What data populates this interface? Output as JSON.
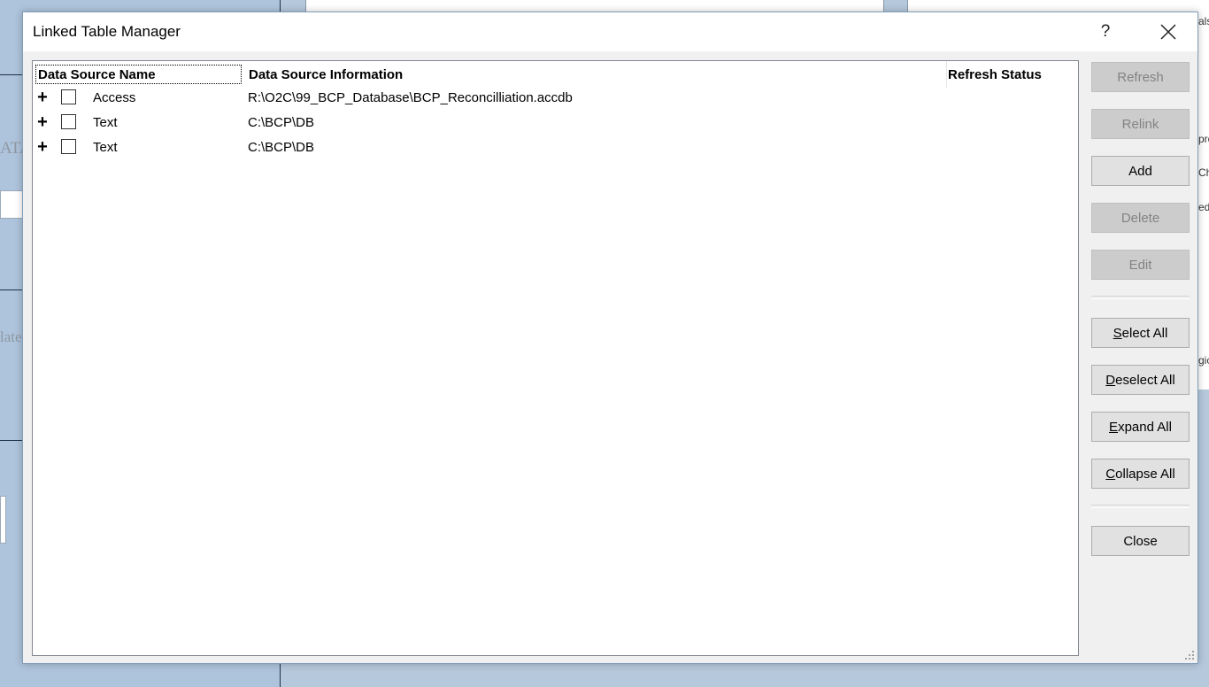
{
  "dialog": {
    "title": "Linked Table Manager",
    "help_label": "?"
  },
  "table": {
    "columns": [
      "Data Source Name",
      "Data Source Information",
      "Refresh Status"
    ],
    "rows": [
      {
        "name": "Access",
        "info": "R:\\O2C\\99_BCP_Database\\BCP_Reconcilliation.accdb",
        "status": "",
        "expander": "+"
      },
      {
        "name": "Text",
        "info": "C:\\BCP\\DB",
        "status": "",
        "expander": "+"
      },
      {
        "name": "Text",
        "info": "C:\\BCP\\DB",
        "status": "",
        "expander": "+"
      }
    ]
  },
  "buttons": {
    "refresh": "Refresh",
    "relink": "Relink",
    "add": "Add",
    "delete": "Delete",
    "edit": "Edit",
    "select_all": {
      "accel": "S",
      "rest": "elect All"
    },
    "deselect_all": {
      "accel": "D",
      "rest": "eselect All"
    },
    "expand_all": {
      "accel": "E",
      "rest": "xpand All"
    },
    "collapse_all": {
      "accel": "C",
      "rest": "ollapse All"
    },
    "close": "Close"
  },
  "background": {
    "left_fragments": [
      "ATA",
      "late"
    ],
    "right_fragments": [
      "als",
      "pro",
      "Ch",
      "ed",
      "gic"
    ]
  },
  "colors": {
    "desktop": "#b5c8dc",
    "dialog_bg": "#f0f0f0",
    "disabled_button": "#cccccc",
    "button": "#e1e1e1"
  }
}
